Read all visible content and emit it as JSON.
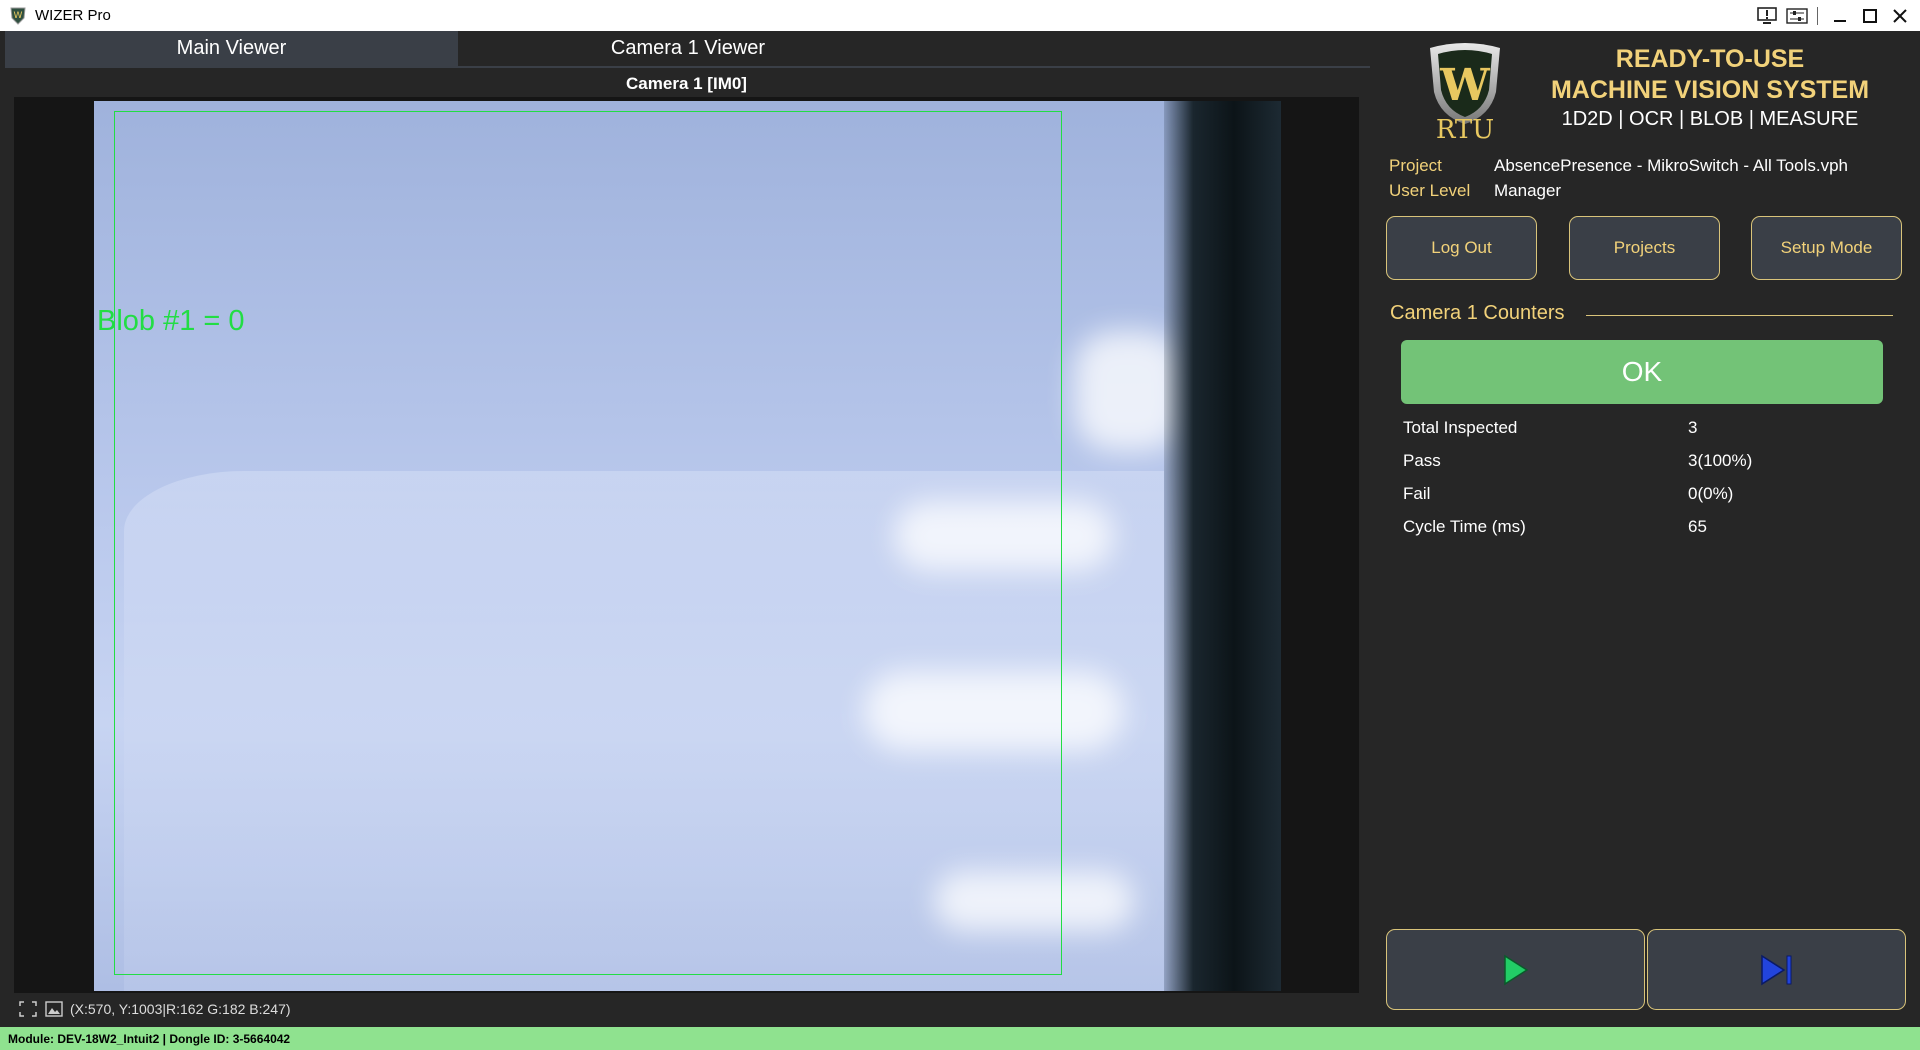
{
  "window": {
    "title": "WIZER Pro"
  },
  "tabs": [
    {
      "label": "Main Viewer",
      "active": true
    },
    {
      "label": "Camera 1 Viewer",
      "active": false
    }
  ],
  "viewer": {
    "camera_label": "Camera 1  [IM0]",
    "overlay_text": "Blob #1 = 0",
    "coord_readout": "(X:570, Y:1003|R:162 G:182 B:247)"
  },
  "brand": {
    "logo_letter": "W",
    "logo_text": "RTU",
    "headline_1": "READY-TO-USE",
    "headline_2": "MACHINE VISION SYSTEM",
    "subline": "1D2D | OCR | BLOB | MEASURE"
  },
  "project": {
    "project_label": "Project",
    "project_value": "AbsencePresence - MikroSwitch - All Tools.vph",
    "user_level_label": "User Level",
    "user_level_value": "Manager"
  },
  "buttons": {
    "logout": "Log Out",
    "projects": "Projects",
    "setup_mode": "Setup Mode"
  },
  "counters": {
    "title": "Camera 1 Counters",
    "result": "OK",
    "rows": [
      {
        "label": "Total Inspected",
        "value": "3"
      },
      {
        "label": "Pass",
        "value": "3(100%)"
      },
      {
        "label": "Fail",
        "value": "0(0%)"
      },
      {
        "label": "Cycle Time (ms)",
        "value": "65"
      }
    ]
  },
  "status": {
    "module": "Module: DEV-18W2_Intuit2 | Dongle ID: 3-5664042"
  },
  "colors": {
    "accent_gold": "#f2d27a",
    "ok_green": "#73c377",
    "roi_green": "#22dd44",
    "status_bar": "#8fe28f",
    "play_icon": "#22cc66",
    "step_icon": "#2244dd"
  },
  "icons": {
    "app": "shield-logo-icon",
    "window_controls": [
      "monitor-alert-icon",
      "settings-sliders-icon",
      "minimize-icon",
      "maximize-icon",
      "close-icon"
    ],
    "viewer_tools": [
      "fit-screen-icon",
      "image-icon"
    ],
    "transport": [
      "play-icon",
      "step-forward-icon"
    ]
  }
}
